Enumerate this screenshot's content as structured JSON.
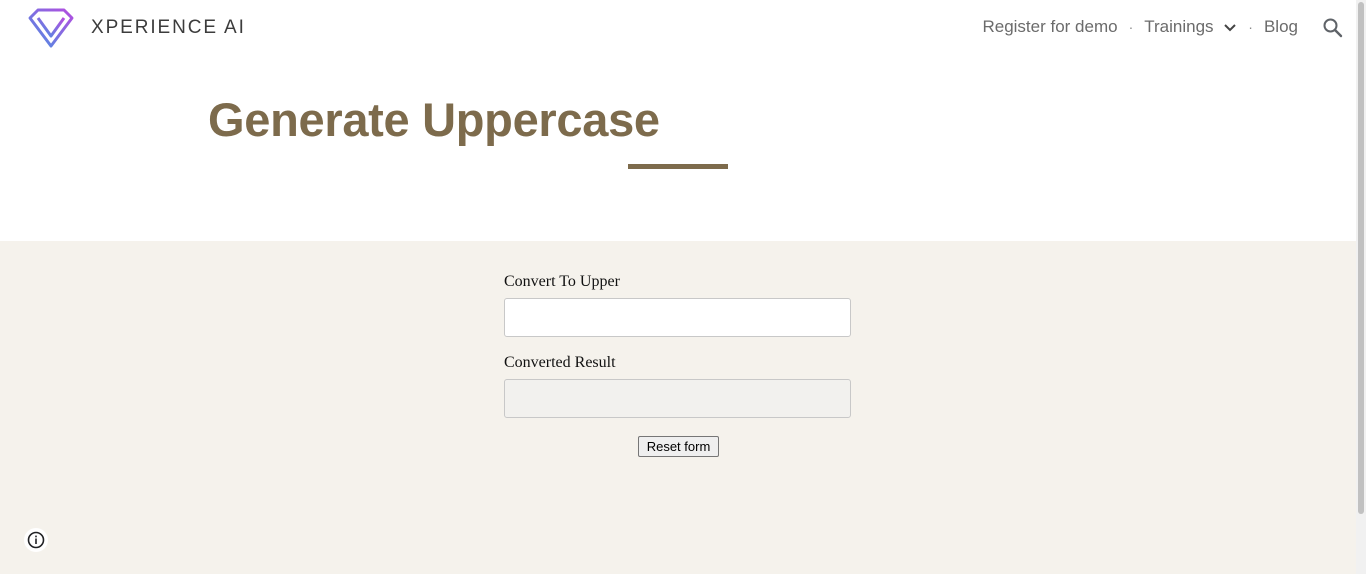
{
  "header": {
    "site_title": "XPERIENCE AI",
    "logo_icon": "diamond-logo-icon",
    "nav": {
      "register_label": "Register for demo",
      "separator": "·",
      "trainings_label": "Trainings",
      "blog_label": "Blog"
    },
    "search_icon": "search-icon"
  },
  "main": {
    "title": "Generate Uppercase"
  },
  "form": {
    "input_label": "Convert To Upper",
    "input_value": "",
    "result_label": "Converted Result",
    "result_value": "",
    "reset_label": "Reset form"
  },
  "footer": {
    "info_icon": "info-icon"
  },
  "colors": {
    "accent": "#7d6b4c",
    "section_bg": "#f5f2ec",
    "logo_gradient_start": "#4a90e2",
    "logo_gradient_end": "#b44de0"
  }
}
